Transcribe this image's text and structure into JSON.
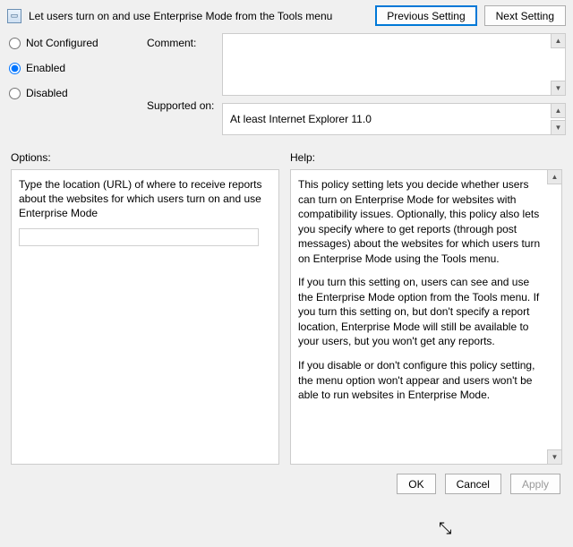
{
  "header": {
    "policy_title": "Let users turn on and use Enterprise Mode from the Tools menu",
    "prev_button": "Previous Setting",
    "next_button": "Next Setting"
  },
  "state": {
    "not_configured_label": "Not Configured",
    "enabled_label": "Enabled",
    "disabled_label": "Disabled",
    "selected": "enabled"
  },
  "labels": {
    "comment": "Comment:",
    "supported_on": "Supported on:",
    "options": "Options:",
    "help": "Help:"
  },
  "supported_on_value": "At least Internet Explorer 11.0",
  "options": {
    "description": "Type the location (URL) of where to receive reports about the websites for which users turn on and use Enterprise Mode",
    "url_value": ""
  },
  "help": {
    "p1": "This policy setting lets you decide whether users can turn on Enterprise Mode for websites with compatibility issues. Optionally, this policy also lets you specify where to get reports (through post messages) about the websites for which users turn on Enterprise Mode using the Tools menu.",
    "p2": "If you turn this setting on, users can see and use the Enterprise Mode option from the Tools menu. If you turn this setting on, but don't specify a report location, Enterprise Mode will still be available to your users, but you won't get any reports.",
    "p3": "If you disable or don't configure this policy setting, the menu option won't appear and users won't be able to run websites in Enterprise Mode."
  },
  "footer": {
    "ok": "OK",
    "cancel": "Cancel",
    "apply": "Apply"
  }
}
